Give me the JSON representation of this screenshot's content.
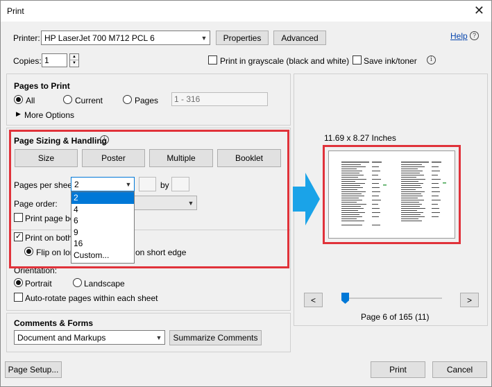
{
  "window": {
    "title": "Print",
    "close_glyph": "✕"
  },
  "printer": {
    "label": "Printer:",
    "value": "HP LaserJet 700 M712 PCL 6",
    "properties_button": "Properties",
    "advanced_button": "Advanced",
    "help_link": "Help"
  },
  "copies": {
    "label": "Copies:",
    "value": "1",
    "grayscale_label": "Print in grayscale (black and white)",
    "grayscale_checked": false,
    "save_ink_label": "Save ink/toner",
    "save_ink_checked": false
  },
  "pages_to_print": {
    "heading": "Pages to Print",
    "all_label": "All",
    "current_label": "Current",
    "pages_label": "Pages",
    "pages_placeholder": "1 - 316",
    "selected": "All",
    "more_options": "More Options"
  },
  "page_sizing": {
    "heading": "Page Sizing & Handling",
    "buttons": [
      "Size",
      "Poster",
      "Multiple",
      "Booklet"
    ],
    "pages_per_sheet_label": "Pages per sheet:",
    "pages_per_sheet_value": "2",
    "by_label": "by",
    "page_order_label": "Page order:",
    "print_borders_label": "Print page bo",
    "print_both_sides_label": "Print on both",
    "flip_long_label": "Flip on lon",
    "flip_short_label": "on short edge",
    "orientation_label": "Orientation:",
    "portrait_label": "Portrait",
    "landscape_label": "Landscape",
    "autorotate_label": "Auto-rotate pages within each sheet",
    "dropdown_options": [
      "2",
      "4",
      "6",
      "9",
      "16",
      "Custom..."
    ],
    "dropdown_selected": "2"
  },
  "comments_forms": {
    "heading": "Comments & Forms",
    "value": "Document and Markups",
    "summarize_button": "Summarize Comments"
  },
  "preview": {
    "size_text": "11.69 x 8.27 Inches",
    "page_status": "Page 6 of 165 (11)",
    "prev_glyph": "<",
    "next_glyph": ">"
  },
  "footer": {
    "page_setup_button": "Page Setup...",
    "print_button": "Print",
    "cancel_button": "Cancel"
  },
  "colors": {
    "accent_blue": "#0078d7",
    "highlight_red": "#e0323a",
    "arrow_cyan": "#1aa3e8"
  }
}
